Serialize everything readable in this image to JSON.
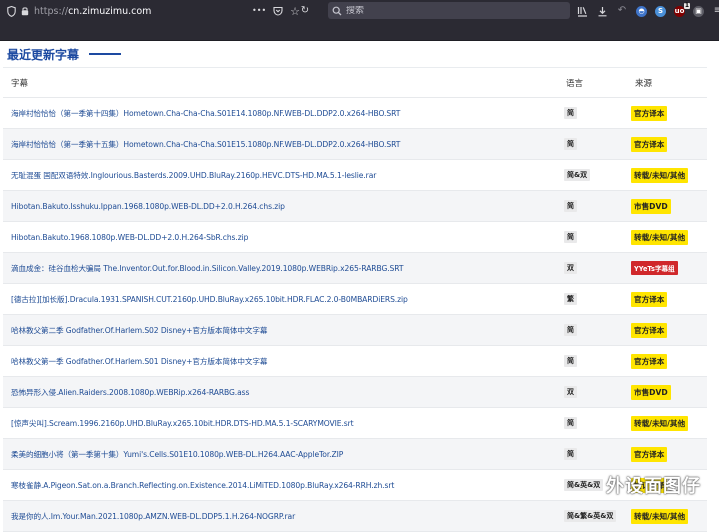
{
  "browser": {
    "url_protocol": "https://",
    "url_host": "cn.zimuzimu.com",
    "search_placeholder": "搜索",
    "more_dots": "•••",
    "ublock_label": "uo",
    "notif_count": "1",
    "s_badge": "S"
  },
  "page": {
    "section_title": "最近更新字幕",
    "columns": {
      "name": "字幕",
      "language": "语言",
      "source": "来源"
    },
    "rows": [
      {
        "name": "海岸村恰恰恰（第一季第十四集）Hometown.Cha-Cha-Cha.S01E14.1080p.NF.WEB-DL.DDP2.0.x264-HBO.SRT",
        "language": "简",
        "source": "官方译本",
        "source_style": "yellow"
      },
      {
        "name": "海岸村恰恰恰（第一季第十五集）Hometown.Cha-Cha-Cha.S01E15.1080p.NF.WEB-DL.DDP2.0.x264-HBO.SRT",
        "language": "简",
        "source": "官方译本",
        "source_style": "yellow"
      },
      {
        "name": "无耻混蛋 国配双语特效.Inglourious.Basterds.2009.UHD.BluRay.2160p.HEVC.DTS-HD.MA.5.1-leslie.rar",
        "language": "简&双",
        "source": "转载/未知/其他",
        "source_style": "yellow"
      },
      {
        "name": "Hibotan.Bakuto.Isshuku.Ippan.1968.1080p.WEB-DL.DD+2.0.H.264.chs.zip",
        "language": "简",
        "source": "市售DVD",
        "source_style": "yellow"
      },
      {
        "name": "Hibotan.Bakuto.1968.1080p.WEB-DL.DD+2.0.H.264-SbR.chs.zip",
        "language": "简",
        "source": "转载/未知/其他",
        "source_style": "yellow"
      },
      {
        "name": "滴血成金：硅谷血检大骗局 The.Inventor.Out.for.Blood.in.Silicon.Valley.2019.1080p.WEBRip.x265-RARBG.SRT",
        "language": "双",
        "source": "YYeTs字幕组",
        "source_style": "red"
      },
      {
        "name": "[德古拉][加长版].Dracula.1931.SPANISH.CUT.2160p.UHD.BluRay.x265.10bit.HDR.FLAC.2.0-B0MBARDiERS.zip",
        "language": "繁",
        "source": "官方译本",
        "source_style": "yellow"
      },
      {
        "name": "哈林教父第二季 Godfather.Of.Harlem.S02 Disney+官方版本简体中文字幕",
        "language": "简",
        "source": "官方译本",
        "source_style": "yellow"
      },
      {
        "name": "哈林教父第一季 Godfather.Of.Harlem.S01 Disney+官方版本简体中文字幕",
        "language": "简",
        "source": "官方译本",
        "source_style": "yellow"
      },
      {
        "name": "恐怖异形入侵.Alien.Raiders.2008.1080p.WEBRip.x264-RARBG.ass",
        "language": "双",
        "source": "市售DVD",
        "source_style": "yellow"
      },
      {
        "name": "[惊声尖叫].Scream.1996.2160p.UHD.BluRay.x265.10bit.HDR.DTS-HD.MA.5.1-SCARYMOVIE.srt",
        "language": "简",
        "source": "转载/未知/其他",
        "source_style": "yellow"
      },
      {
        "name": "柔美的细胞小将（第一季第十集）Yumi's.Cells.S01E10.1080p.WEB-DL.H264.AAC-AppleTor.ZIP",
        "language": "简",
        "source": "官方译本",
        "source_style": "yellow"
      },
      {
        "name": "寒枝雀静.A.Pigeon.Sat.on.a.Branch.Reflecting.on.Existence.2014.LiMiTED.1080p.BluRay.x264-RRH.zh.srt",
        "language": "简&英&双",
        "source": "校订翻译",
        "source_style": "yellow"
      },
      {
        "name": "我是你的人.Im.Your.Man.2021.1080p.AMZN.WEB-DL.DDP5.1.H.264-NOGRP.rar",
        "language": "简&繁&英&双",
        "source": "转载/未知/其他",
        "source_style": "yellow"
      }
    ]
  },
  "watermark": "外设面图仔",
  "colors": {
    "accent": "#1d4aa1",
    "link": "#1e4b94",
    "badge_yellow": "#ffe500",
    "badge_red": "#d0282b",
    "chrome_bg": "#2b2a33"
  }
}
